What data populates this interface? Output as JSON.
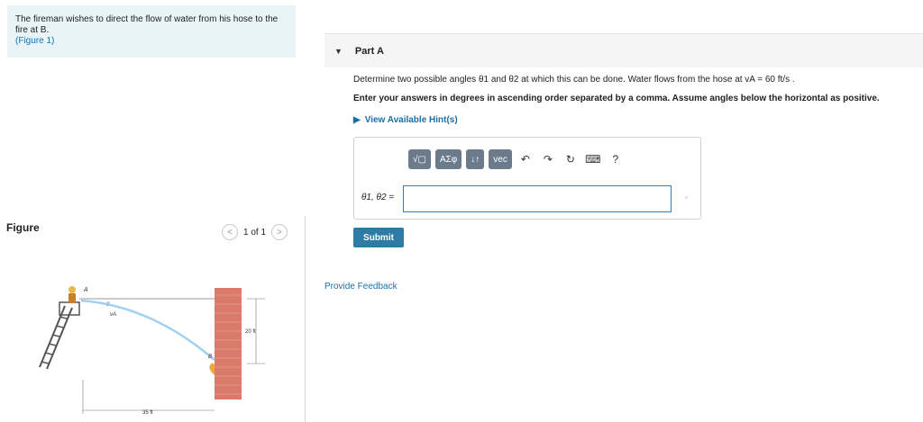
{
  "problem": {
    "text": "The fireman wishes to direct the flow of water from his hose to the fire at B.",
    "figure_link": "(Figure 1)"
  },
  "figure": {
    "label": "Figure",
    "pager": "1 of 1",
    "prev_icon": "chevron-left-icon",
    "next_icon": "chevron-right-icon",
    "point_a": "A",
    "point_b": "B",
    "angle_label": "θ",
    "velocity_label": "vA",
    "height_label": "20 ft",
    "distance_label": "35 ft"
  },
  "part": {
    "title": "Part A",
    "question": "Determine two possible angles θ1 and θ2 at which this can be done. Water flows from the hose at vA = 60 ft/s .",
    "instructions": "Enter your answers in degrees in ascending order separated by a comma. Assume angles below the horizontal as positive.",
    "hints_label": "View Available Hint(s)",
    "answer_label": "θ1, θ2 =",
    "answer_value": "",
    "submit_label": "Submit",
    "feedback_label": "Provide Feedback"
  },
  "toolbar": {
    "templates_label": "√▢",
    "greek_label": "ΑΣφ",
    "arrows_label": "↓↑",
    "vec_label": "vec",
    "undo_icon": "undo-icon",
    "redo_icon": "redo-icon",
    "reset_icon": "reset-icon",
    "keyboard_icon": "keyboard-icon",
    "help_label": "?"
  }
}
